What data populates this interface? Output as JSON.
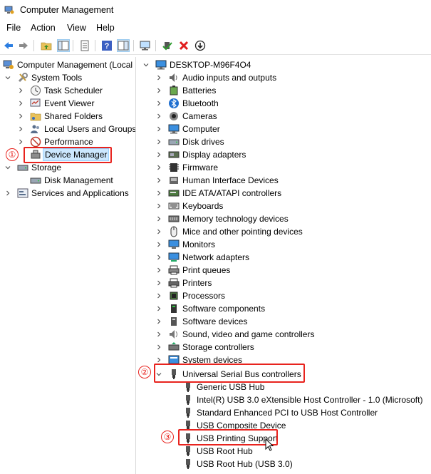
{
  "window": {
    "title": "Computer Management"
  },
  "menu": [
    "File",
    "Action",
    "View",
    "Help"
  ],
  "left_tree": {
    "root": "Computer Management (Local",
    "system_tools": "System Tools",
    "task_scheduler": "Task Scheduler",
    "event_viewer": "Event Viewer",
    "shared_folders": "Shared Folders",
    "local_users": "Local Users and Groups",
    "performance": "Performance",
    "device_manager": "Device Manager",
    "storage": "Storage",
    "disk_management": "Disk Management",
    "services": "Services and Applications"
  },
  "right_tree": {
    "root": "DESKTOP-M96F4O4",
    "categories": [
      "Audio inputs and outputs",
      "Batteries",
      "Bluetooth",
      "Cameras",
      "Computer",
      "Disk drives",
      "Display adapters",
      "Firmware",
      "Human Interface Devices",
      "IDE ATA/ATAPI controllers",
      "Keyboards",
      "Memory technology devices",
      "Mice and other pointing devices",
      "Monitors",
      "Network adapters",
      "Print queues",
      "Printers",
      "Processors",
      "Software components",
      "Software devices",
      "Sound, video and game controllers",
      "Storage controllers",
      "System devices"
    ],
    "usb": "Universal Serial Bus controllers",
    "usb_children": [
      "Generic USB Hub",
      "Intel(R) USB 3.0 eXtensible Host Controller - 1.0 (Microsoft)",
      "Standard Enhanced PCI to USB Host Controller",
      "USB Composite Device",
      "USB Printing Support",
      "USB Root Hub",
      "USB Root Hub (USB 3.0)"
    ]
  },
  "annotations": {
    "step1": "①",
    "step2": "②",
    "step3": "③"
  },
  "colors": {
    "highlight": "#e8231e",
    "selection": "#cce8ff"
  }
}
